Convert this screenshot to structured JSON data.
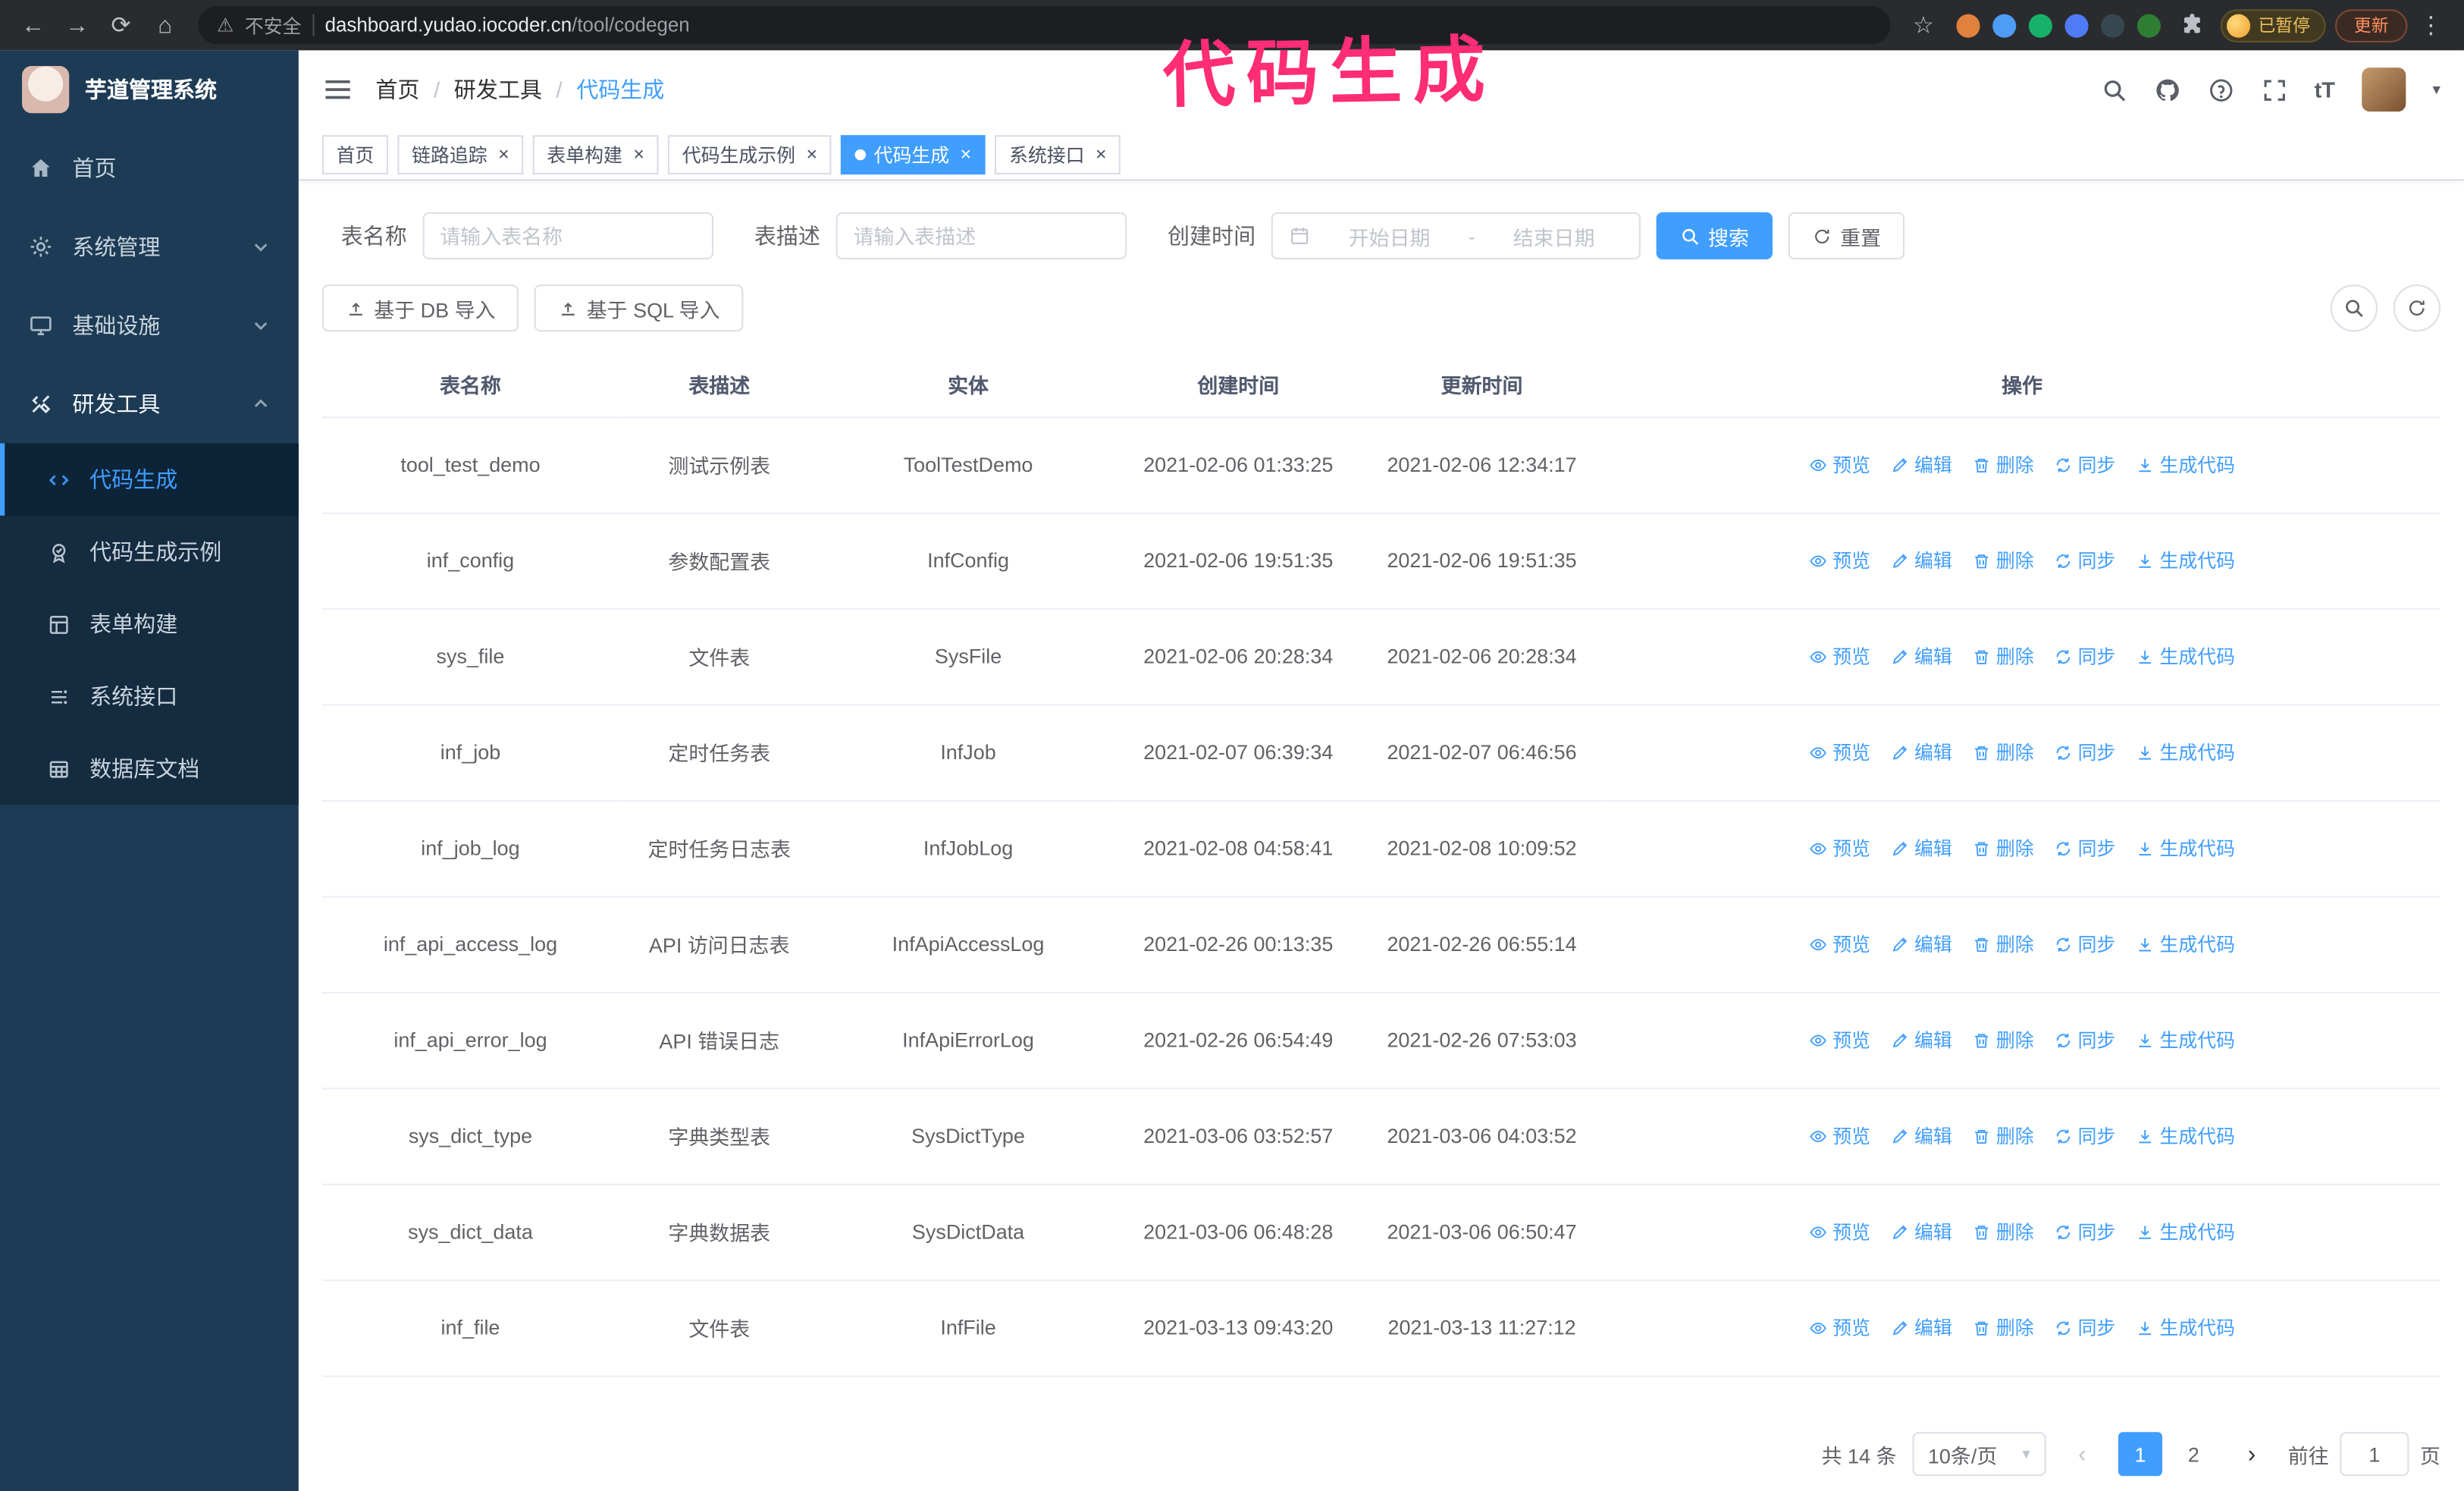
{
  "annotation": {
    "text": "代码生成",
    "color": "#ff2d75"
  },
  "browser": {
    "security_label": "不安全",
    "url_host": "dashboard.yudao.iocoder.cn",
    "url_path": "/tool/codegen",
    "paused_badge": "已暂停",
    "update_button": "更新",
    "extensions": [
      {
        "name": "extension-icon-1",
        "color": "#e0823d"
      },
      {
        "name": "extension-icon-2",
        "color": "#4d9df6"
      },
      {
        "name": "extension-icon-3",
        "color": "#17b26a"
      },
      {
        "name": "extension-icon-4",
        "color": "#4f7bf7"
      },
      {
        "name": "extension-icon-5",
        "color": "#37474f"
      },
      {
        "name": "extension-icon-6",
        "color": "#2e7d32"
      }
    ]
  },
  "sidebar": {
    "app_title": "芋道管理系统",
    "items": [
      {
        "label": "首页",
        "icon": "home",
        "chevron": ""
      },
      {
        "label": "系统管理",
        "icon": "gear",
        "chevron": "down"
      },
      {
        "label": "基础设施",
        "icon": "infra",
        "chevron": "down"
      },
      {
        "label": "研发工具",
        "icon": "tools",
        "chevron": "up",
        "open": true
      }
    ],
    "subitems": [
      {
        "label": "代码生成",
        "icon": "code",
        "active": true
      },
      {
        "label": "代码生成示例",
        "icon": "badge"
      },
      {
        "label": "表单构建",
        "icon": "form"
      },
      {
        "label": "系统接口",
        "icon": "api"
      },
      {
        "label": "数据库文档",
        "icon": "db"
      }
    ]
  },
  "header": {
    "breadcrumb": [
      {
        "label": "首页"
      },
      {
        "label": "研发工具"
      },
      {
        "label": "代码生成",
        "current": true
      }
    ],
    "separator": "/",
    "font_size_label": "tT"
  },
  "tabs": [
    {
      "label": "首页",
      "closable": false,
      "active": false
    },
    {
      "label": "链路追踪",
      "closable": true,
      "active": false
    },
    {
      "label": "表单构建",
      "closable": true,
      "active": false
    },
    {
      "label": "代码生成示例",
      "closable": true,
      "active": false
    },
    {
      "label": "代码生成",
      "closable": true,
      "active": true
    },
    {
      "label": "系统接口",
      "closable": true,
      "active": false
    }
  ],
  "filters": {
    "table_name_label": "表名称",
    "table_name_placeholder": "请输入表名称",
    "table_desc_label": "表描述",
    "table_desc_placeholder": "请输入表描述",
    "create_time_label": "创建时间",
    "date_start_placeholder": "开始日期",
    "date_separator": "-",
    "date_end_placeholder": "结束日期",
    "search_button": "搜索",
    "reset_button": "重置"
  },
  "toolbar": {
    "import_db": "基于 DB 导入",
    "import_sql": "基于 SQL 导入"
  },
  "table": {
    "columns": [
      "表名称",
      "表描述",
      "实体",
      "创建时间",
      "更新时间",
      "操作"
    ],
    "row_actions": [
      {
        "key": "preview",
        "label": "预览",
        "icon": "eye"
      },
      {
        "key": "edit",
        "label": "编辑",
        "icon": "edit"
      },
      {
        "key": "delete",
        "label": "删除",
        "icon": "trash"
      },
      {
        "key": "sync",
        "label": "同步",
        "icon": "sync"
      },
      {
        "key": "generate",
        "label": "生成代码",
        "icon": "gen"
      }
    ],
    "rows": [
      {
        "name": "tool_test_demo",
        "desc": "测试示例表",
        "entity": "ToolTestDemo",
        "created": "2021-02-06 01:33:25",
        "updated": "2021-02-06 12:34:17"
      },
      {
        "name": "inf_config",
        "desc": "参数配置表",
        "entity": "InfConfig",
        "created": "2021-02-06 19:51:35",
        "updated": "2021-02-06 19:51:35"
      },
      {
        "name": "sys_file",
        "desc": "文件表",
        "entity": "SysFile",
        "created": "2021-02-06 20:28:34",
        "updated": "2021-02-06 20:28:34"
      },
      {
        "name": "inf_job",
        "desc": "定时任务表",
        "entity": "InfJob",
        "created": "2021-02-07 06:39:34",
        "updated": "2021-02-07 06:46:56"
      },
      {
        "name": "inf_job_log",
        "desc": "定时任务日志表",
        "entity": "InfJobLog",
        "created": "2021-02-08 04:58:41",
        "updated": "2021-02-08 10:09:52"
      },
      {
        "name": "inf_api_access_log",
        "desc": "API 访问日志表",
        "entity": "InfApiAccessLog",
        "created": "2021-02-26 00:13:35",
        "updated": "2021-02-26 06:55:14"
      },
      {
        "name": "inf_api_error_log",
        "desc": "API 错误日志",
        "entity": "InfApiErrorLog",
        "created": "2021-02-26 06:54:49",
        "updated": "2021-02-26 07:53:03"
      },
      {
        "name": "sys_dict_type",
        "desc": "字典类型表",
        "entity": "SysDictType",
        "created": "2021-03-06 03:52:57",
        "updated": "2021-03-06 04:03:52"
      },
      {
        "name": "sys_dict_data",
        "desc": "字典数据表",
        "entity": "SysDictData",
        "created": "2021-03-06 06:48:28",
        "updated": "2021-03-06 06:50:47"
      },
      {
        "name": "inf_file",
        "desc": "文件表",
        "entity": "InfFile",
        "created": "2021-03-13 09:43:20",
        "updated": "2021-03-13 11:27:12"
      }
    ]
  },
  "pagination": {
    "total_text": "共 14 条",
    "page_size": "10条/页",
    "pages": [
      {
        "label": "1",
        "active": true
      },
      {
        "label": "2",
        "active": false
      }
    ],
    "goto_label": "前往",
    "goto_value": "1",
    "unit_label": "页"
  },
  "colors": {
    "accent": "#409eff",
    "sidebar_bg": "#1d3b55",
    "submenu_bg": "#142b40"
  }
}
